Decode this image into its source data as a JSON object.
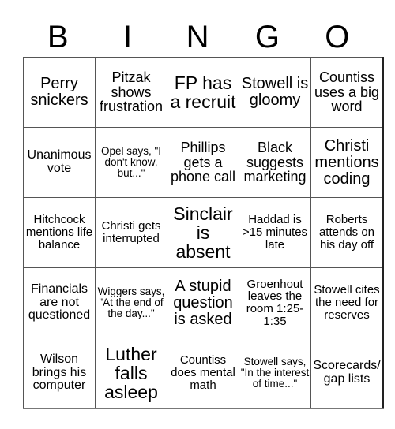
{
  "header": {
    "letters": [
      "B",
      "I",
      "N",
      "G",
      "O"
    ]
  },
  "board": {
    "rows": [
      [
        {
          "text": "Perry snickers"
        },
        {
          "text": "Pitzak shows frustration"
        },
        {
          "text": "FP has a recruit"
        },
        {
          "text": "Stowell is gloomy"
        },
        {
          "text": "Countiss uses a big word"
        }
      ],
      [
        {
          "text": "Unanimous vote"
        },
        {
          "text": "Opel says, \"I don't know, but...\""
        },
        {
          "text": "Phillips gets a phone call"
        },
        {
          "text": "Black suggests marketing"
        },
        {
          "text": "Christi mentions coding"
        }
      ],
      [
        {
          "text": "Hitchcock mentions life balance"
        },
        {
          "text": "Christi gets interrupted"
        },
        {
          "text": "Sinclair is absent"
        },
        {
          "text": "Haddad is >15 minutes late"
        },
        {
          "text": "Roberts attends on his day off"
        }
      ],
      [
        {
          "text": "Financials are not questioned"
        },
        {
          "text": "Wiggers says, \"At the end of the day...\""
        },
        {
          "text": "A stupid question is asked"
        },
        {
          "text": "Groenhout leaves the room 1:25-1:35"
        },
        {
          "text": "Stowell cites the need for reserves"
        }
      ],
      [
        {
          "text": "Wilson brings his computer"
        },
        {
          "text": "Luther falls asleep"
        },
        {
          "text": "Countiss does mental math"
        },
        {
          "text": "Stowell says, \"In the interest of time...\""
        },
        {
          "text": "Scorecards/ gap lists"
        }
      ]
    ]
  }
}
